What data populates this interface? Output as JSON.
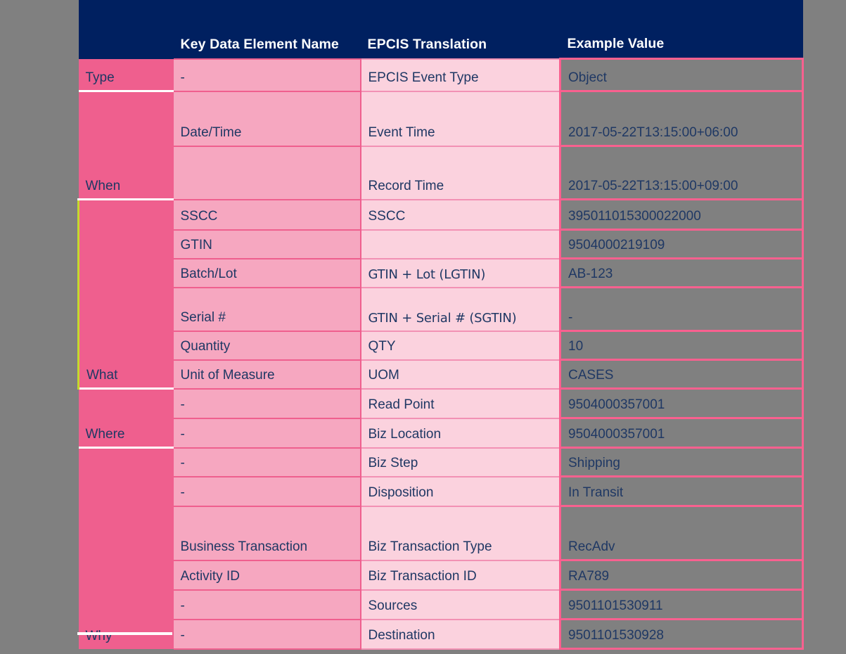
{
  "page": {
    "background_color": "#808080",
    "accent_lime": "#c5d92d",
    "header_bg": "#002060",
    "category_bg": "#ef5f8e",
    "kde_bg": "#f6a7c0",
    "epcis_bg": "#fbd2de",
    "value_border": "#f9608f",
    "text_color": "#1f3864"
  },
  "table": {
    "headers": {
      "category": "",
      "key_data_element_name": "Key Data Element Name",
      "epcis_translation": "EPCIS Translation",
      "example_value": "Example Value"
    },
    "groups": [
      {
        "category": "Type",
        "rows": [
          {
            "kde": "-",
            "epcis": "EPCIS Event Type",
            "value": "Object"
          }
        ]
      },
      {
        "category": "When",
        "rows": [
          {
            "kde": "Date/Time",
            "epcis": "Event Time",
            "value": "2017-05-22T13:15:00+06:00"
          },
          {
            "kde": "",
            "epcis": "Record Time",
            "value": "2017-05-22T13:15:00+09:00"
          }
        ]
      },
      {
        "category": "What",
        "rows": [
          {
            "kde": "SSCC",
            "epcis": "SSCC",
            "value": "395011015300022000"
          },
          {
            "kde": "GTIN",
            "epcis": "",
            "value": "9504000219109"
          },
          {
            "kde": "Batch/Lot",
            "epcis": "GTIN + Lot (LGTIN)",
            "value": "AB-123"
          },
          {
            "kde": "Serial #",
            "epcis": "GTIN + Serial # (SGTIN)",
            "value": "-"
          },
          {
            "kde": "Quantity",
            "epcis": "QTY",
            "value": "10"
          },
          {
            "kde": "Unit of Measure",
            "epcis": "UOM",
            "value": "CASES"
          }
        ]
      },
      {
        "category": "Where",
        "rows": [
          {
            "kde": "-",
            "epcis": "Read Point",
            "value": "9504000357001"
          },
          {
            "kde": "-",
            "epcis": "Biz Location",
            "value": "9504000357001"
          }
        ]
      },
      {
        "category": "Why",
        "rows": [
          {
            "kde": "-",
            "epcis": "Biz Step",
            "value": "Shipping"
          },
          {
            "kde": "-",
            "epcis": "Disposition",
            "value": "In Transit"
          },
          {
            "kde": "Business Transaction",
            "epcis": "Biz Transaction Type",
            "value": "RecAdv"
          },
          {
            "kde": "Activity ID",
            "epcis": "Biz Transaction ID",
            "value": "RA789"
          },
          {
            "kde": "-",
            "epcis": "Sources",
            "value": "9501101530911"
          },
          {
            "kde": "-",
            "epcis": "Destination",
            "value": "9501101530928"
          }
        ]
      }
    ]
  }
}
